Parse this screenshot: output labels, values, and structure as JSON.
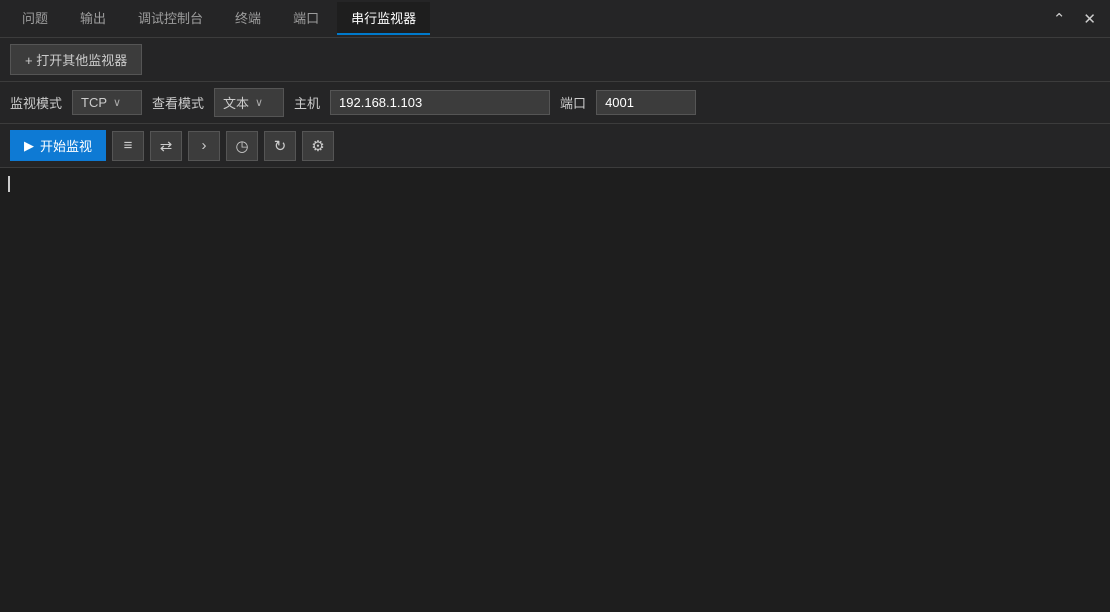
{
  "tabs": {
    "items": [
      {
        "label": "问题",
        "active": false
      },
      {
        "label": "输出",
        "active": false
      },
      {
        "label": "调试控制台",
        "active": false
      },
      {
        "label": "终端",
        "active": false
      },
      {
        "label": "端口",
        "active": false
      },
      {
        "label": "串行监视器",
        "active": true
      }
    ],
    "window_minimize": "⌃",
    "window_close": "✕"
  },
  "toolbar1": {
    "open_btn_label": "+ 打开其他监视器"
  },
  "toolbar2": {
    "monitor_mode_label": "监视模式",
    "monitor_mode_value": "TCP",
    "view_mode_label": "查看模式",
    "view_mode_value": "文本",
    "host_label": "主机",
    "host_value": "192.168.1.103",
    "port_label": "端口",
    "port_value": "4001"
  },
  "toolbar3": {
    "start_btn_label": "开始监视",
    "start_icon": "▶"
  },
  "icons": {
    "list_icon": "≡",
    "connect_icon": "⇄",
    "arrow_icon": "›",
    "clock_icon": "◷",
    "refresh_icon": "↻",
    "settings_icon": "⚙"
  }
}
